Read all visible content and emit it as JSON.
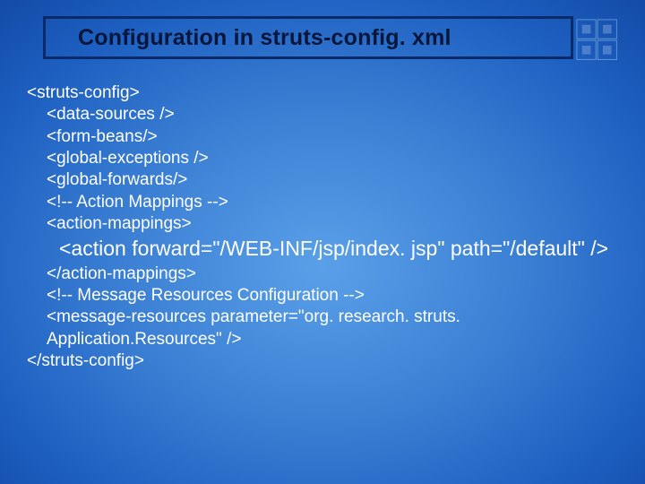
{
  "title": "Configuration in struts-config. xml",
  "lines": {
    "l1": "<struts-config>",
    "l2": "<data-sources />",
    "l3": "<form-beans/>",
    "l4": "<global-exceptions />",
    "l5": "<global-forwards/>",
    "l6": "<!-- Action Mappings -->",
    "l7": "<action-mappings>",
    "l8": "<action forward=\"/WEB-INF/jsp/index. jsp\" path=\"/default\" />",
    "l9": "</action-mappings>",
    "l10": "<!-- Message Resources Configuration -->",
    "l11": "<message-resources parameter=\"org. research. struts. Application.Resources\" />",
    "l12": "</struts-config>"
  }
}
